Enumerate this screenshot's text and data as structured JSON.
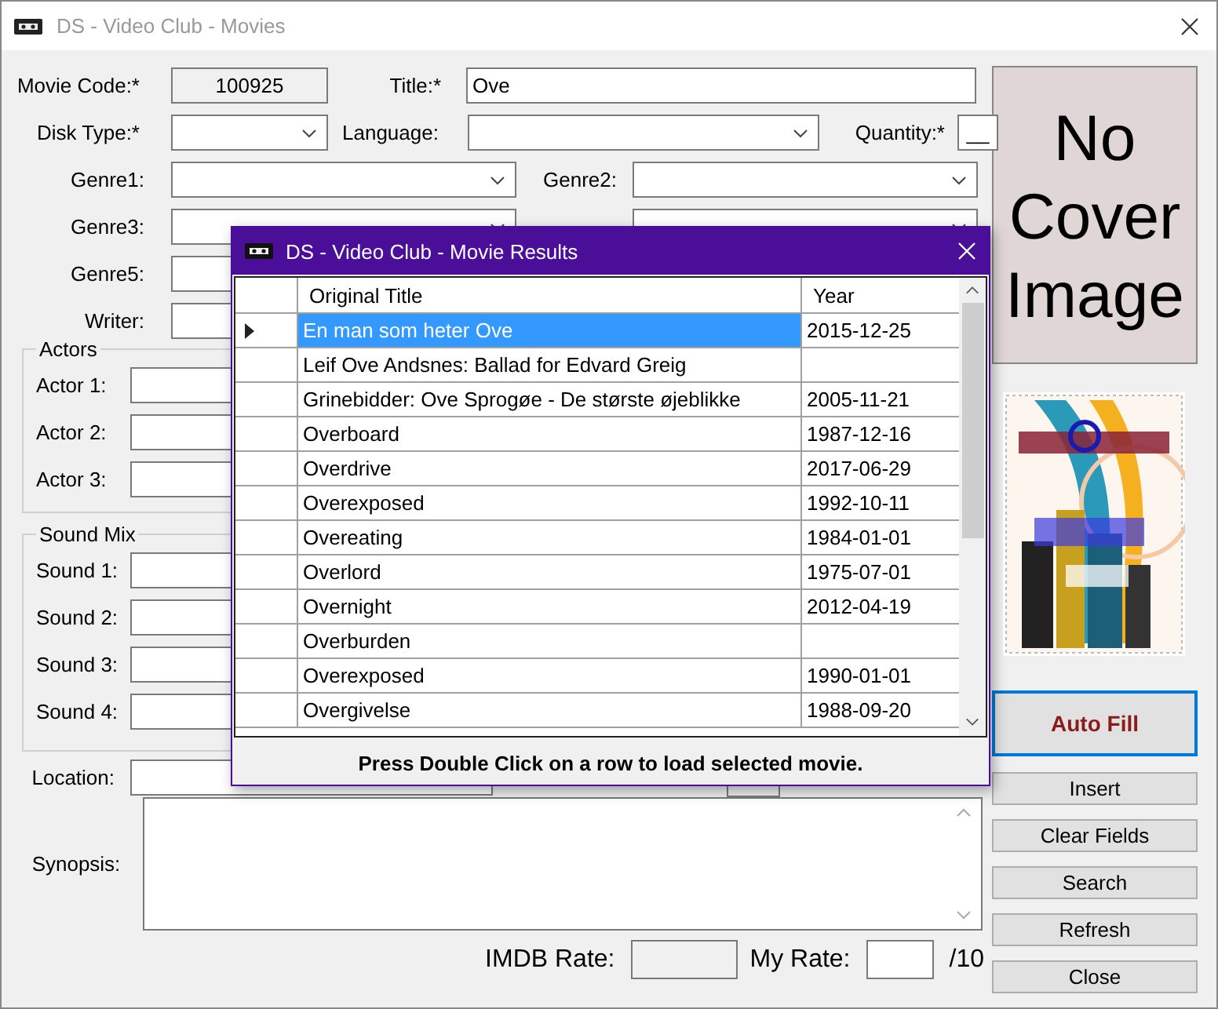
{
  "window": {
    "title": "DS - Video Club - Movies"
  },
  "form": {
    "movie_code": {
      "label": "Movie Code:*",
      "value": "100925"
    },
    "title": {
      "label": "Title:*",
      "value": "Ove"
    },
    "disk_type": {
      "label": "Disk Type:*"
    },
    "language": {
      "label": "Language:"
    },
    "quantity": {
      "label": "Quantity:*",
      "value": "__"
    },
    "genres": [
      {
        "label": "Genre1:",
        "kind": "dropdown"
      },
      {
        "label": "Genre2:",
        "kind": "dropdown"
      },
      {
        "label": "Genre3:",
        "kind": "dropdown"
      },
      {
        "kind": "dropdown"
      },
      {
        "label": "Genre5:",
        "kind": "text"
      }
    ],
    "writer": {
      "label": "Writer:"
    },
    "actors": {
      "title": "Actors",
      "labels": [
        "Actor 1:",
        "Actor 2:",
        "Actor 3:"
      ]
    },
    "sound_mix": {
      "title": "Sound Mix",
      "labels": [
        "Sound 1:",
        "Sound 2:",
        "Sound 3:",
        "Sound 4:"
      ]
    },
    "location": {
      "label": "Location:"
    },
    "synopsis": {
      "label": "Synopsis:"
    },
    "imdb_rate": {
      "label": "IMDB Rate:"
    },
    "my_rate": {
      "label": "My Rate:",
      "suffix": "/10"
    }
  },
  "cover": {
    "text": "No Cover Image"
  },
  "buttons": [
    {
      "label": "Auto Fill",
      "kind": "primary"
    },
    {
      "label": "Insert",
      "kind": "normal"
    },
    {
      "label": "Clear Fields",
      "kind": "normal"
    },
    {
      "label": "Search",
      "kind": "normal"
    },
    {
      "label": "Refresh",
      "kind": "normal"
    },
    {
      "label": "Close",
      "kind": "normal"
    }
  ],
  "dialog": {
    "title": "DS - Video Club - Movie Results",
    "columns": [
      "Original Title",
      "Year"
    ],
    "rows": [
      {
        "title": "En man som heter Ove",
        "year": "2015-12-25",
        "selected": true
      },
      {
        "title": "Leif Ove Andsnes: Ballad for Edvard Greig",
        "year": "",
        "selected": false
      },
      {
        "title": "Grinebidder: Ove Sprogøe - De største øjeblikke",
        "year": "2005-11-21",
        "selected": false
      },
      {
        "title": "Overboard",
        "year": "1987-12-16",
        "selected": false
      },
      {
        "title": "Overdrive",
        "year": "2017-06-29",
        "selected": false
      },
      {
        "title": "Overexposed",
        "year": "1992-10-11",
        "selected": false
      },
      {
        "title": "Overeating",
        "year": "1984-01-01",
        "selected": false
      },
      {
        "title": "Overlord",
        "year": "1975-07-01",
        "selected": false
      },
      {
        "title": "Overnight",
        "year": "2012-04-19",
        "selected": false
      },
      {
        "title": "Overburden",
        "year": "",
        "selected": false
      },
      {
        "title": "Overexposed",
        "year": "1990-01-01",
        "selected": false
      },
      {
        "title": "Overgivelse",
        "year": "1988-09-20",
        "selected": false
      }
    ],
    "footer": "Press Double Click on a row to load selected movie."
  }
}
